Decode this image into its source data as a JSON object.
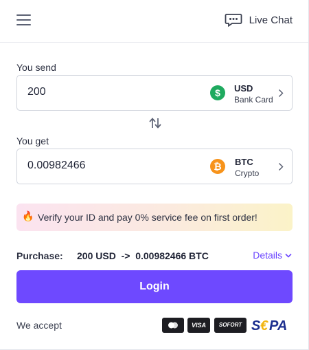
{
  "header": {
    "menu_icon": "hamburger-menu-icon",
    "live_chat_icon": "chat-bubble-icon",
    "live_chat_label": "Live Chat"
  },
  "send": {
    "label": "You send",
    "value": "200",
    "currency_code": "USD",
    "currency_sub": "Bank Card",
    "coin_symbol": "$",
    "coin_color": "#1faa5f"
  },
  "get": {
    "label": "You get",
    "value": "0.00982466",
    "currency_code": "BTC",
    "currency_sub": "Crypto",
    "coin_symbol": "₿",
    "coin_color": "#f7931a"
  },
  "promo": {
    "icon": "🔥",
    "text": "Verify your ID and pay 0% service fee on first order!"
  },
  "purchase": {
    "label": "Purchase:",
    "summary": "200 USD  ->  0.00982466 BTC",
    "details_label": "Details"
  },
  "login_label": "Login",
  "footer": {
    "accept_label": "We accept",
    "payment_methods": [
      "Mastercard",
      "VISA",
      "SOFORT",
      "SEPA"
    ]
  },
  "colors": {
    "accent": "#6e49ff",
    "link": "#6b46ff"
  }
}
